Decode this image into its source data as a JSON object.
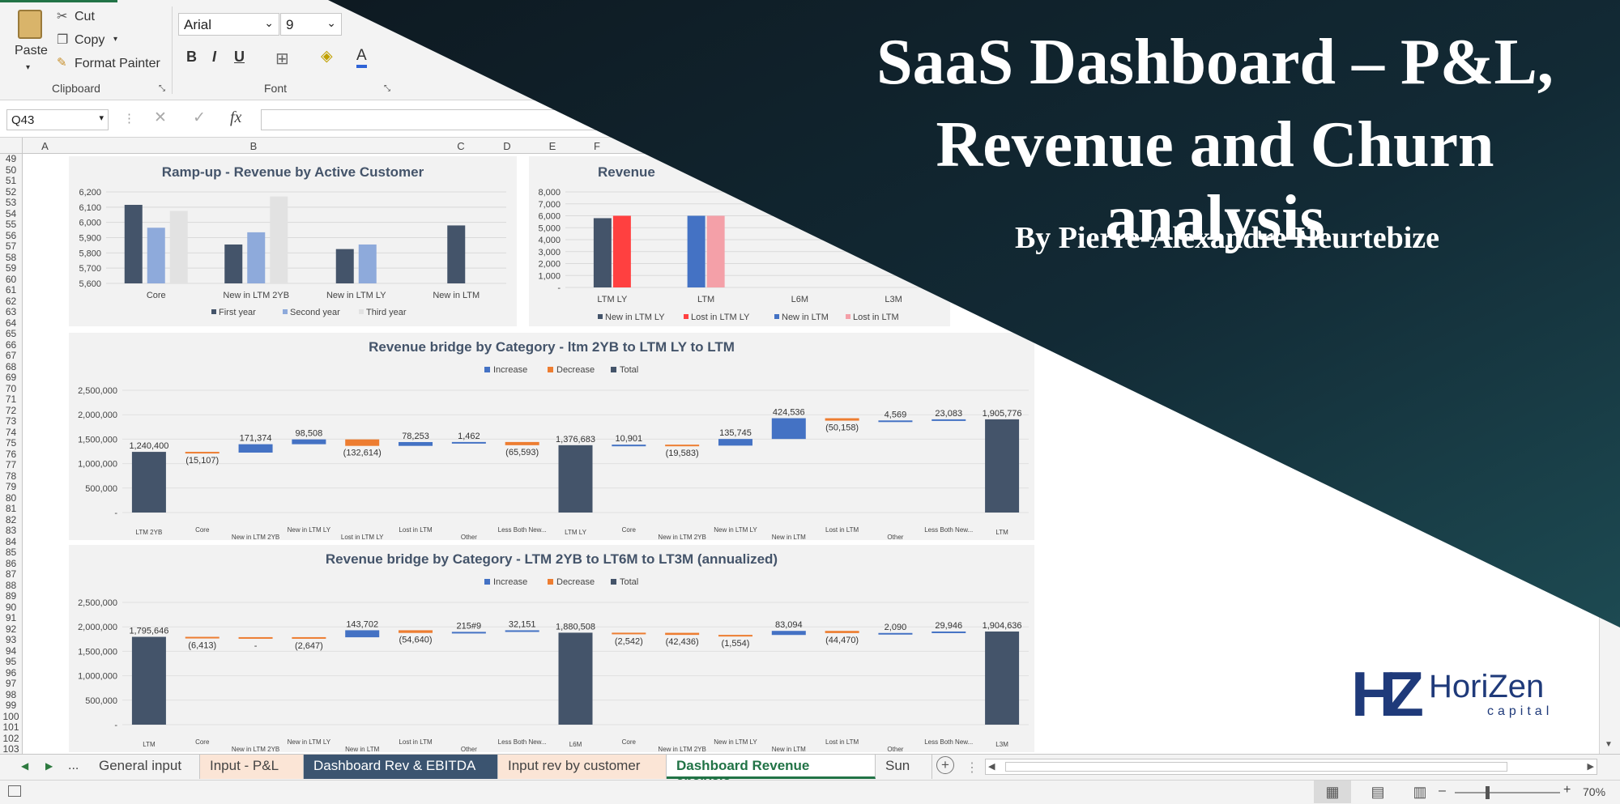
{
  "ribbon": {
    "paste": "Paste",
    "cut": "Cut",
    "copy": "Copy",
    "format_painter": "Format Painter",
    "clipboard_group": "Clipboard",
    "font_group": "Font",
    "font_name": "Arial",
    "font_size": "9",
    "bold": "B",
    "italic": "I",
    "underline": "U"
  },
  "formula_bar": {
    "name_box": "Q43",
    "fx": "fx",
    "value": ""
  },
  "columns": [
    "A",
    "B",
    "C",
    "D",
    "E",
    "F"
  ],
  "rows": [
    "49",
    "50",
    "51",
    "52",
    "53",
    "54",
    "55",
    "56",
    "57",
    "58",
    "59",
    "60",
    "61",
    "62",
    "63",
    "64",
    "65",
    "66",
    "67",
    "68",
    "69",
    "70",
    "71",
    "72",
    "73",
    "74",
    "75",
    "76",
    "77",
    "78",
    "79",
    "80",
    "81",
    "82",
    "83",
    "84",
    "85",
    "86",
    "87",
    "88",
    "89",
    "90",
    "91",
    "92",
    "93",
    "94",
    "95",
    "96",
    "97",
    "98",
    "99",
    "100",
    "101",
    "102",
    "103"
  ],
  "overlay": {
    "title_line1": "SaaS Dashboard – P&L,",
    "title_line2": "Revenue and Churn analysis",
    "byline": "By Pierre-Alexandre Heurtebize",
    "logo_main": "HoriZen",
    "logo_sub": "capital",
    "logo_mark": "HZ"
  },
  "chart1": {
    "title": "Ramp-up - Revenue by Active Customer",
    "categories": [
      "Core",
      "New in LTM 2YB",
      "New in LTM LY",
      "New in LTM"
    ],
    "yticks": [
      "6,200",
      "6,100",
      "6,000",
      "5,900",
      "5,800",
      "5,700",
      "5,600"
    ],
    "ylim": [
      5600,
      6200
    ],
    "series": [
      {
        "name": "First year",
        "color": "#44546a",
        "values": [
          6115,
          5855,
          5825,
          5980
        ]
      },
      {
        "name": "Second year",
        "color": "#8eaadb",
        "values": [
          5965,
          5935,
          5855,
          null
        ]
      },
      {
        "name": "Third year",
        "color": "#e2e2e2",
        "values": [
          6075,
          6170,
          null,
          null
        ]
      }
    ]
  },
  "chart2": {
    "title": "Revenue",
    "categories": [
      "LTM LY",
      "LTM",
      "L6M",
      "L3M"
    ],
    "yticks": [
      "8,000",
      "7,000",
      "6,000",
      "5,000",
      "4,000",
      "3,000",
      "2,000",
      "1,000",
      "-"
    ],
    "ylim": [
      0,
      8000
    ],
    "series": [
      {
        "name": "New in LTM LY",
        "color": "#44546a",
        "values": [
          5800,
          null,
          null,
          null
        ]
      },
      {
        "name": "Lost in LTM LY",
        "color": "#ff4040",
        "values": [
          6000,
          null,
          null,
          null
        ]
      },
      {
        "name": "New in LTM",
        "color": "#4472c4",
        "values": [
          null,
          6000,
          null,
          null
        ]
      },
      {
        "name": "Lost in LTM",
        "color": "#f4a0a8",
        "values": [
          null,
          6000,
          null,
          null
        ]
      }
    ]
  },
  "chart3": {
    "title": "Revenue bridge by Category - ltm 2YB to LTM LY to LTM",
    "legend": [
      "Increase",
      "Decrease",
      "Total"
    ],
    "yticks": [
      "2,500,000",
      "2,000,000",
      "1,500,000",
      "1,000,000",
      "500,000",
      "-"
    ],
    "ylim": [
      0,
      2500000
    ],
    "bars": [
      {
        "cat": "LTM 2YB",
        "type": "total",
        "value": 1240400,
        "label": "1,240,400"
      },
      {
        "cat": "Core",
        "type": "decrease",
        "value": -15107,
        "label": "(15,107)"
      },
      {
        "cat": "New in LTM 2YB",
        "type": "increase",
        "value": 171374,
        "label": "171,374"
      },
      {
        "cat": "New in LTM LY",
        "type": "increase",
        "value": 98508,
        "label": "98,508"
      },
      {
        "cat": "Lost in LTM LY",
        "type": "decrease",
        "value": -132614,
        "label": "(132,614)"
      },
      {
        "cat": "Lost in LTM",
        "type": "increase",
        "value": 78253,
        "label": "78,253"
      },
      {
        "cat": "Other",
        "type": "increase",
        "value": 1462,
        "label": "1,462"
      },
      {
        "cat": "Less Both New...",
        "type": "decrease",
        "value": -65593,
        "label": "(65,593)"
      },
      {
        "cat": "LTM LY",
        "type": "total",
        "value": 1376683,
        "label": "1,376,683"
      },
      {
        "cat": "Core",
        "type": "increase",
        "value": 10901,
        "label": "10,901"
      },
      {
        "cat": "New in LTM 2YB",
        "type": "decrease",
        "value": -19583,
        "label": "(19,583)"
      },
      {
        "cat": "New in LTM LY",
        "type": "increase",
        "value": 135745,
        "label": "135,745"
      },
      {
        "cat": "New in LTM",
        "type": "increase",
        "value": 424536,
        "label": "424,536"
      },
      {
        "cat": "Lost in LTM",
        "type": "decrease",
        "value": -50158,
        "label": "(50,158)"
      },
      {
        "cat": "Other",
        "type": "increase",
        "value": 4569,
        "label": "4,569"
      },
      {
        "cat": "Less Both New...",
        "type": "increase",
        "value": 23083,
        "label": "23,083"
      },
      {
        "cat": "LTM",
        "type": "total",
        "value": 1905776,
        "label": "1,905,776"
      }
    ]
  },
  "chart4": {
    "title": "Revenue bridge by Category - LTM 2YB to LT6M  to LT3M (annualized)",
    "legend": [
      "Increase",
      "Decrease",
      "Total"
    ],
    "yticks": [
      "2,500,000",
      "2,000,000",
      "1,500,000",
      "1,000,000",
      "500,000",
      "-"
    ],
    "ylim": [
      0,
      2500000
    ],
    "bars": [
      {
        "cat": "LTM",
        "type": "total",
        "value": 1795646,
        "label": "1,795,646"
      },
      {
        "cat": "Core",
        "type": "decrease",
        "value": -6413,
        "label": "(6,413)"
      },
      {
        "cat": "New in LTM 2YB",
        "type": "decrease",
        "value": 0,
        "label": "-"
      },
      {
        "cat": "New in LTM LY",
        "type": "decrease",
        "value": -2647,
        "label": "(2,647)"
      },
      {
        "cat": "New in LTM",
        "type": "increase",
        "value": 143702,
        "label": "143,702"
      },
      {
        "cat": "Lost in LTM",
        "type": "decrease",
        "value": -54640,
        "label": "(54,640)"
      },
      {
        "cat": "Other",
        "type": "increase",
        "value": 21589,
        "label": "215#9"
      },
      {
        "cat": "Less Both New...",
        "type": "increase",
        "value": 32151,
        "label": "32,151"
      },
      {
        "cat": "L6M",
        "type": "total",
        "value": 1880508,
        "label": "1,880,508"
      },
      {
        "cat": "Core",
        "type": "decrease",
        "value": -2542,
        "label": "(2,542)"
      },
      {
        "cat": "New in LTM 2YB",
        "type": "decrease",
        "value": -42436,
        "label": "(42,436)"
      },
      {
        "cat": "New in LTM LY",
        "type": "decrease",
        "value": -1554,
        "label": "(1,554)"
      },
      {
        "cat": "New in LTM",
        "type": "increase",
        "value": 83094,
        "label": "83,094"
      },
      {
        "cat": "Lost in LTM",
        "type": "decrease",
        "value": -44470,
        "label": "(44,470)"
      },
      {
        "cat": "Other",
        "type": "increase",
        "value": 2090,
        "label": "2,090"
      },
      {
        "cat": "Less Both New...",
        "type": "increase",
        "value": 29946,
        "label": "29,946"
      },
      {
        "cat": "L3M",
        "type": "total",
        "value": 1904636,
        "label": "1,904,636"
      }
    ]
  },
  "colors": {
    "increase": "#4472c4",
    "decrease": "#ed7d31",
    "total": "#44546a",
    "accent": "#217346"
  },
  "sheet_tabs": [
    "General input",
    "Input - P&L",
    "Dashboard Rev & EBITDA",
    "Input rev by customer",
    "Dashboard Revenue analysis",
    "Sun ..."
  ],
  "active_tab": "Dashboard Revenue analysis",
  "status": {
    "zoom": "70%",
    "zoom_minus": "–",
    "zoom_plus": "+"
  },
  "nav": {
    "prev": "◀",
    "next": "▶",
    "more": "..."
  }
}
